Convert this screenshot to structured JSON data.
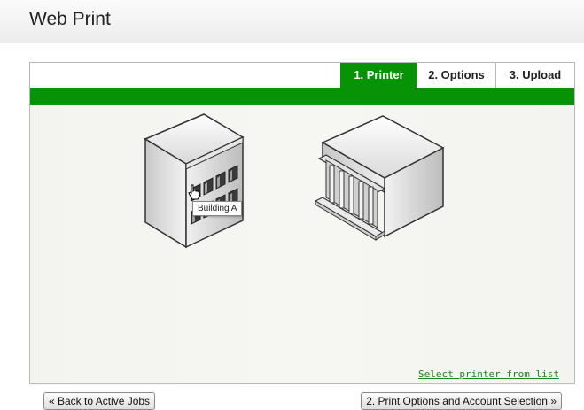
{
  "header": {
    "title": "Web Print"
  },
  "tabs": [
    {
      "label": "1. Printer",
      "active": true
    },
    {
      "label": "2. Options",
      "active": false
    },
    {
      "label": "3. Upload",
      "active": false
    }
  ],
  "buildings": [
    {
      "name": "Building A",
      "icon": "office-building-icon",
      "hovered": true
    },
    {
      "name": "",
      "icon": "columned-building-icon",
      "hovered": false
    }
  ],
  "tooltip": {
    "text": "Building A"
  },
  "links": {
    "select_from_list": "Select printer from list"
  },
  "buttons": {
    "back": "« Back to Active Jobs",
    "next": "2. Print Options and Account Selection »"
  },
  "colors": {
    "accent": "#069406",
    "link": "#1a8a1a",
    "panel_bg": "#f4f4f0"
  }
}
